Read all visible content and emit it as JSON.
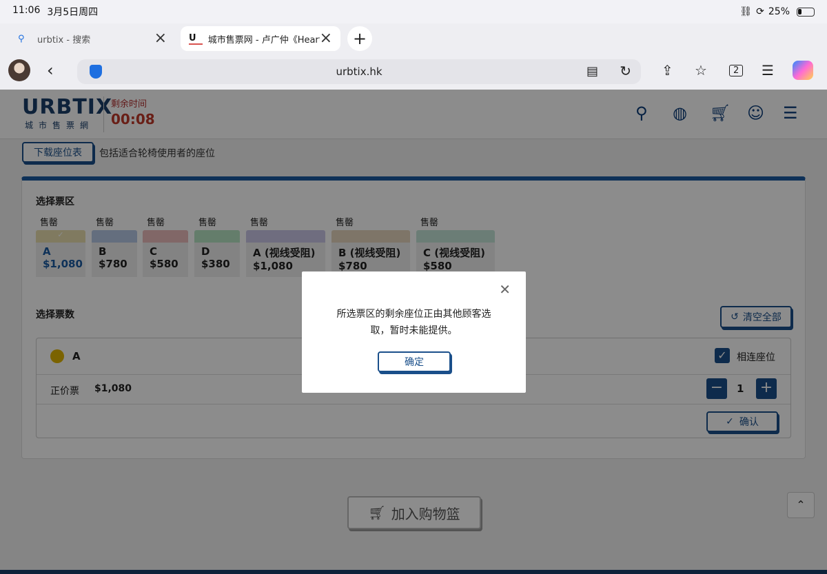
{
  "status": {
    "time": "11:06",
    "date": "3月5日周四",
    "battery": "25%"
  },
  "tabs": [
    {
      "favicon": "search-icon",
      "title": "urbtix - 搜索"
    },
    {
      "favicon": "U",
      "title": "城市售票网 - 卢广仲《Heart"
    }
  ],
  "browser": {
    "url": "urbtix.hk",
    "tab_count": "2"
  },
  "site": {
    "logo_big": "URBTIX",
    "logo_small": "城市售票網",
    "timer_label": "剩余时间",
    "timer_value": "00:08"
  },
  "page": {
    "download_label": "下载座位表",
    "download_note": "包括适合轮椅使用者的座位",
    "select_zone_title": "选择票区",
    "zones": [
      {
        "status": "售罄",
        "name": "A",
        "price": "$1,080",
        "color": "#e9dfb0"
      },
      {
        "status": "售罄",
        "name": "B",
        "price": "$780",
        "color": "#b7c9e6"
      },
      {
        "status": "售罄",
        "name": "C",
        "price": "$580",
        "color": "#ecbcbc"
      },
      {
        "status": "售罄",
        "name": "D",
        "price": "$380",
        "color": "#b7e3c4"
      },
      {
        "status": "售罄",
        "name": "A (视线受阻)",
        "price": "$1,080",
        "color": "#cbc6e8"
      },
      {
        "status": "售罄",
        "name": "B (视线受阻)",
        "price": "$780",
        "color": "#e6d6bd"
      },
      {
        "status": "售罄",
        "name": "C (视线受阻)",
        "price": "$580",
        "color": "#c4e4d8"
      }
    ],
    "select_qty_title": "选择票数",
    "reset_label": "清空全部",
    "selected_zone": "A",
    "adjacent_label": "相连座位",
    "ticket_type": "正价票",
    "ticket_price": "$1,080",
    "quantity": "1",
    "confirm_label": "确认",
    "cart_label": "加入购物篮"
  },
  "modal": {
    "message": "所选票区的剩余座位正由其他顾客选取，暂时未能提供。",
    "ok_label": "确定"
  }
}
